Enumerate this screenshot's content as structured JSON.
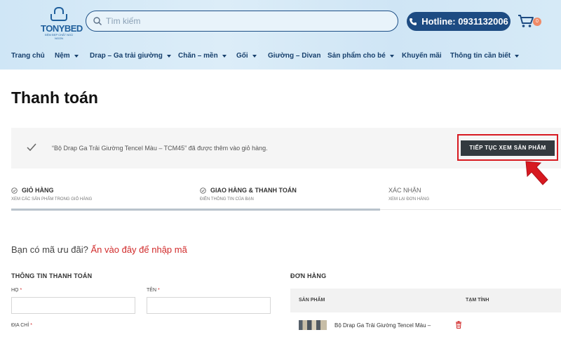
{
  "header": {
    "logo": {
      "name": "TONYBED",
      "tagline": "ĐỆM ĐẸP CHẤT NGỦ NGON"
    },
    "search": {
      "placeholder": "Tìm kiếm",
      "value": ""
    },
    "hotline": {
      "label": "Hotline: 0931132006"
    },
    "cart": {
      "count": "0"
    },
    "nav": [
      {
        "label": "Trang chủ",
        "dropdown": false
      },
      {
        "label": "Nệm",
        "dropdown": true
      },
      {
        "label": "Drap – Ga trải giường",
        "dropdown": true
      },
      {
        "label": "Chăn – mền",
        "dropdown": true
      },
      {
        "label": "Gối",
        "dropdown": true
      },
      {
        "label": "Giường – Divan",
        "dropdown": false
      },
      {
        "label": "Sản phẩm cho bé",
        "dropdown": true
      },
      {
        "label": "Khuyến mãi",
        "dropdown": false
      },
      {
        "label": "Thông tin cần biết",
        "dropdown": true
      }
    ]
  },
  "page": {
    "title": "Thanh toán"
  },
  "notice": {
    "message": "“Bộ Drap Ga Trải Giường Tencel Màu – TCM45” đã được thêm vào giỏ hàng.",
    "continue_label": "TIẾP TỤC XEM SẢN PHẨM"
  },
  "steps": [
    {
      "title": "GIỎ HÀNG",
      "subtitle": "XEM CÁC SẢN PHẨM TRONG GIỎ HÀNG",
      "done": true
    },
    {
      "title": "GIAO HÀNG & THANH TOÁN",
      "subtitle": "ĐIỀN THÔNG TIN CỦA BẠN",
      "done": true
    },
    {
      "title": "XÁC NHẬN",
      "subtitle": "XEM LẠI ĐƠN HÀNG",
      "done": false
    }
  ],
  "coupon": {
    "prompt": "Bạn có mã ưu đãi?",
    "link": "Ấn vào đây để nhập mã"
  },
  "billing": {
    "title": "THÔNG TIN THANH TOÁN",
    "fields": {
      "last_name": {
        "label": "HỌ",
        "value": ""
      },
      "first_name": {
        "label": "TÊN",
        "value": ""
      },
      "address": {
        "label": "ĐỊA CHỈ",
        "value": ""
      }
    },
    "required_mark": "*"
  },
  "order": {
    "title": "ĐƠN HÀNG",
    "col_product": "SẢN PHẨM",
    "col_subtotal": "TẠM TÍNH",
    "items": [
      {
        "name": "Bộ Drap Ga Trải Giường Tencel Màu –"
      }
    ]
  },
  "colors": {
    "primary": "#1d4b82",
    "accent_red": "#d12b2b",
    "button_dark": "#333a3f"
  }
}
